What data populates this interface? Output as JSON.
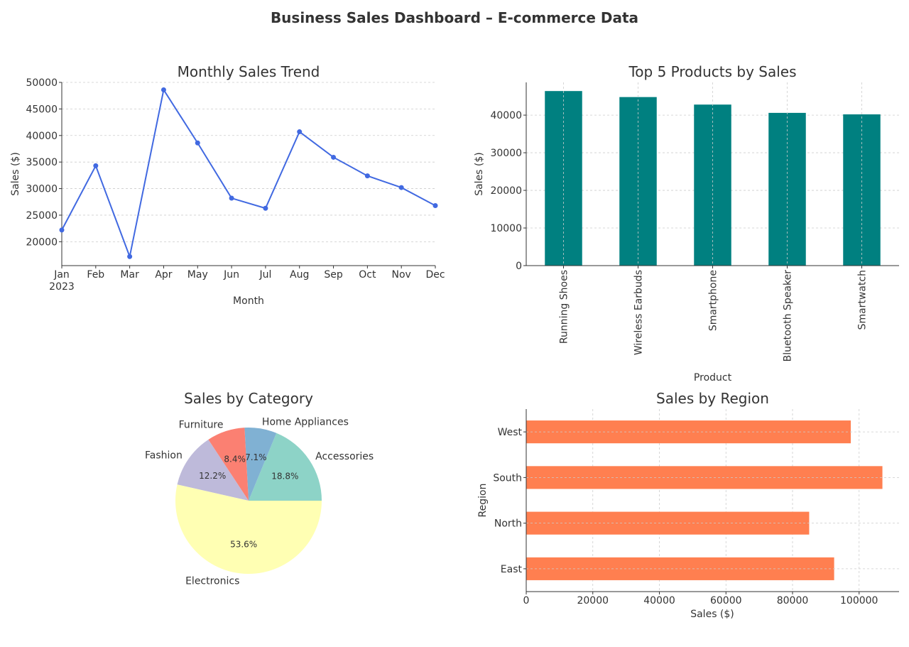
{
  "page_title": "Business Sales Dashboard – E-commerce Data",
  "chart_data": [
    {
      "type": "line",
      "title": "Monthly Sales Trend",
      "xlabel": "Month",
      "ylabel": "Sales ($)",
      "year_label": "2023",
      "categories": [
        "Jan",
        "Feb",
        "Mar",
        "Apr",
        "May",
        "Jun",
        "Jul",
        "Aug",
        "Sep",
        "Oct",
        "Nov",
        "Dec"
      ],
      "values": [
        22200,
        34300,
        17200,
        48600,
        38600,
        28200,
        26300,
        40700,
        35900,
        32400,
        30200,
        26800
      ],
      "ylim": [
        15500,
        50000
      ],
      "yticks": [
        20000,
        25000,
        30000,
        35000,
        40000,
        45000,
        50000
      ],
      "grid": "horizontal",
      "color": "#4169e1"
    },
    {
      "type": "bar",
      "title": "Top 5 Products by Sales",
      "xlabel": "Product",
      "ylabel": "Sales ($)",
      "categories": [
        "Running Shoes",
        "Wireless Earbuds",
        "Smartphone",
        "Bluetooth Speaker",
        "Smartwatch"
      ],
      "values": [
        46400,
        44800,
        42800,
        40600,
        40200
      ],
      "ylim": [
        0,
        48700
      ],
      "yticks": [
        0,
        10000,
        20000,
        30000,
        40000
      ],
      "grid": "both",
      "color": "#008080"
    },
    {
      "type": "pie",
      "title": "Sales by Category",
      "labels": [
        "Accessories",
        "Home Appliances",
        "Furniture",
        "Fashion",
        "Electronics"
      ],
      "values": [
        18.8,
        7.1,
        8.4,
        12.2,
        53.6
      ],
      "autopct": [
        "18.8%",
        "7.1%",
        "8.4%",
        "12.2%",
        "53.6%"
      ],
      "colors": [
        "#8dd3c7",
        "#80b1d3",
        "#fb8072",
        "#bebada",
        "#ffffb3"
      ]
    },
    {
      "type": "bar",
      "orientation": "horizontal",
      "title": "Sales by Region",
      "xlabel": "Sales ($)",
      "ylabel": "Region",
      "categories": [
        "East",
        "North",
        "South",
        "West"
      ],
      "values": [
        92500,
        85000,
        107000,
        97500
      ],
      "xlim": [
        0,
        112000
      ],
      "xticks": [
        0,
        20000,
        40000,
        60000,
        80000,
        100000
      ],
      "grid": "both",
      "color": "#ff7f50"
    }
  ]
}
